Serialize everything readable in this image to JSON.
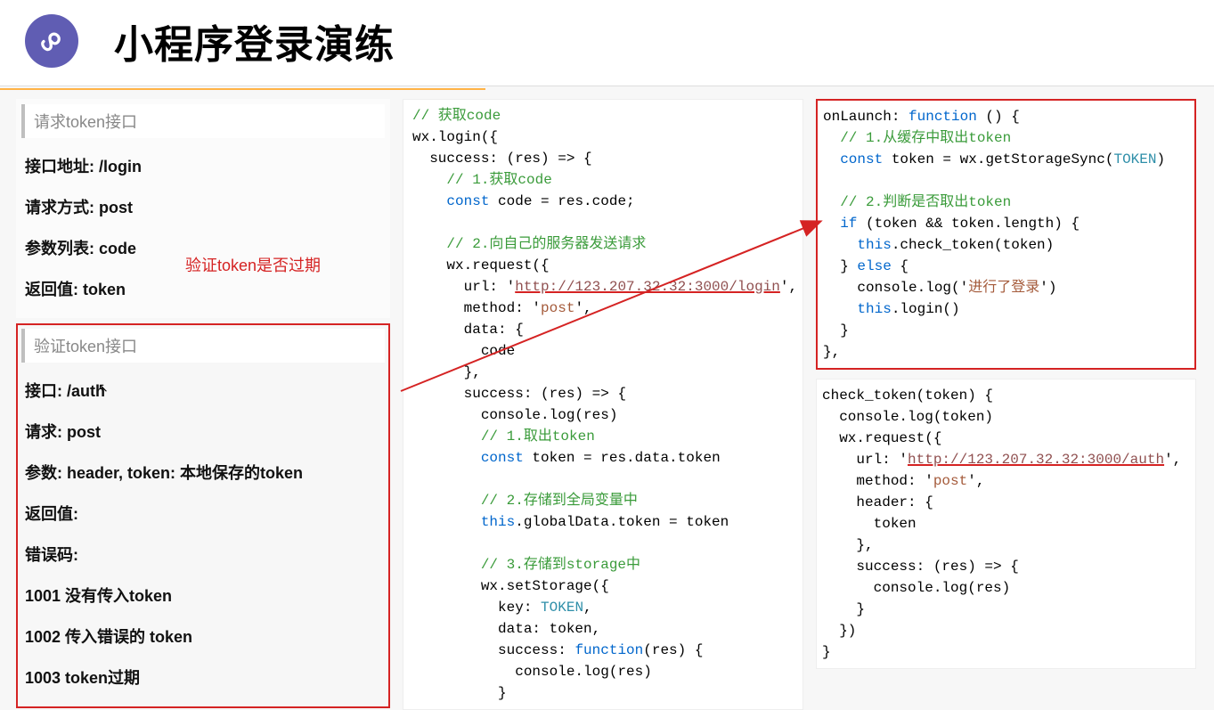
{
  "header": {
    "title": "小程序登录演练",
    "logo_alt": "wechat-miniprogram-logo"
  },
  "annotation": {
    "red_note": "验证token是否过期"
  },
  "left": {
    "api1": {
      "section_title": "请求token接口",
      "address": "接口地址: /login",
      "method": "请求方式: post",
      "params": "参数列表: code",
      "return": "返回值: token"
    },
    "api2": {
      "section_title": "验证token接口",
      "address": "接口: /auth",
      "method": "请求: post",
      "params": "参数: header, token: 本地保存的token",
      "return": "返回值:",
      "errors_label": "错误码:",
      "err1": "1001 没有传入token",
      "err2": "1002 传入错误的 token",
      "err3": "1003 token过期"
    }
  },
  "mid_code": [
    {
      "t": "comment",
      "v": "// 获取code"
    },
    {
      "t": "plain",
      "v": "wx.login({"
    },
    {
      "t": "plain",
      "v": "  success: (res) => {"
    },
    {
      "t": "comment",
      "v": "    // 1.获取code"
    },
    {
      "t": "kw_line",
      "kw": "const",
      "rest": " code = res.code;"
    },
    {
      "t": "blank",
      "v": ""
    },
    {
      "t": "comment",
      "v": "    // 2.向自己的服务器发送请求"
    },
    {
      "t": "plain",
      "v": "    wx.request({"
    },
    {
      "t": "url_line",
      "pre": "      url: '",
      "url": "http://123.207.32.32:3000/login",
      "post": "',"
    },
    {
      "t": "str_line",
      "pre": "      method: '",
      "str": "post",
      "post": "',"
    },
    {
      "t": "plain",
      "v": "      data: {"
    },
    {
      "t": "plain",
      "v": "        code"
    },
    {
      "t": "plain",
      "v": "      },"
    },
    {
      "t": "plain",
      "v": "      success: (res) => {"
    },
    {
      "t": "plain",
      "v": "        console.log(res)"
    },
    {
      "t": "comment",
      "v": "        // 1.取出token"
    },
    {
      "t": "kw_line2",
      "pre": "        ",
      "kw": "const",
      "rest": " token = res.data.token"
    },
    {
      "t": "blank",
      "v": ""
    },
    {
      "t": "comment",
      "v": "        // 2.存储到全局变量中"
    },
    {
      "t": "this_line",
      "pre": "        ",
      "kw": "this",
      "rest": ".globalData.token = token"
    },
    {
      "t": "blank",
      "v": ""
    },
    {
      "t": "comment",
      "v": "        // 3.存储到storage中"
    },
    {
      "t": "plain",
      "v": "        wx.setStorage({"
    },
    {
      "t": "type_line",
      "pre": "          key: ",
      "type": "TOKEN",
      "post": ","
    },
    {
      "t": "plain",
      "v": "          data: token,"
    },
    {
      "t": "fn_line",
      "pre": "          success: ",
      "kw": "function",
      "rest": "(res) {"
    },
    {
      "t": "plain",
      "v": "            console.log(res)"
    },
    {
      "t": "plain",
      "v": "          }"
    }
  ],
  "right_code1": [
    {
      "t": "fn_line",
      "pre": "onLaunch: ",
      "kw": "function",
      "rest": " () {"
    },
    {
      "t": "comment",
      "v": "  // 1.从缓存中取出token"
    },
    {
      "t": "tok_line",
      "pre": "  ",
      "kw": "const",
      "mid": " token = wx.getStorageSync(",
      "type": "TOKEN",
      "post": ")"
    },
    {
      "t": "blank",
      "v": ""
    },
    {
      "t": "comment",
      "v": "  // 2.判断是否取出token"
    },
    {
      "t": "if_line",
      "pre": "  ",
      "kw": "if",
      "rest": " (token && token.length) {"
    },
    {
      "t": "this_line",
      "pre": "    ",
      "kw": "this",
      "rest": ".check_token(token)"
    },
    {
      "t": "else_line",
      "pre": "  } ",
      "kw": "else",
      "rest": " {"
    },
    {
      "t": "str_line",
      "pre": "    console.log('",
      "str": "进行了登录",
      "post": "')"
    },
    {
      "t": "this_line",
      "pre": "    ",
      "kw": "this",
      "rest": ".login()"
    },
    {
      "t": "plain",
      "v": "  }"
    },
    {
      "t": "plain",
      "v": "},"
    }
  ],
  "right_code2": [
    {
      "t": "plain",
      "v": "check_token(token) {"
    },
    {
      "t": "plain",
      "v": "  console.log(token)"
    },
    {
      "t": "plain",
      "v": "  wx.request({"
    },
    {
      "t": "url_line",
      "pre": "    url: '",
      "url": "http://123.207.32.32:3000/auth",
      "post": "',"
    },
    {
      "t": "str_line",
      "pre": "    method: '",
      "str": "post",
      "post": "',"
    },
    {
      "t": "plain",
      "v": "    header: {"
    },
    {
      "t": "plain",
      "v": "      token"
    },
    {
      "t": "plain",
      "v": "    },"
    },
    {
      "t": "plain",
      "v": "    success: (res) => {"
    },
    {
      "t": "plain",
      "v": "      console.log(res)"
    },
    {
      "t": "plain",
      "v": "    }"
    },
    {
      "t": "plain",
      "v": "  })"
    },
    {
      "t": "plain",
      "v": "}"
    }
  ]
}
